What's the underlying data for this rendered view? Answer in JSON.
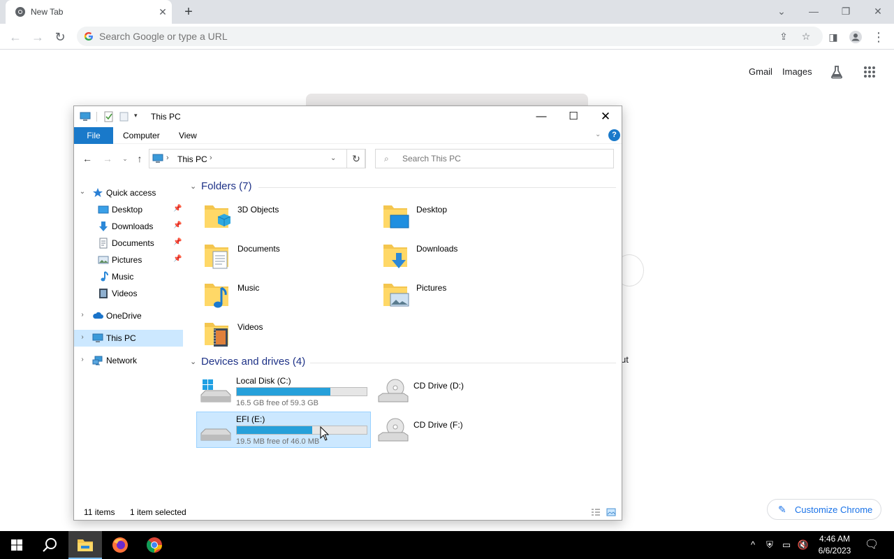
{
  "chrome": {
    "tab_title": "New Tab",
    "omnibox_placeholder": "Search Google or type a URL",
    "links": {
      "gmail": "Gmail",
      "images": "Images"
    },
    "partial_text": "ut",
    "customize_label": "Customize Chrome"
  },
  "explorer": {
    "title": "This PC",
    "ribbon_tabs": {
      "file": "File",
      "computer": "Computer",
      "view": "View"
    },
    "address_crumb": "This PC",
    "search_placeholder": "Search This PC",
    "tree": {
      "quick_access": "Quick access",
      "desktop": "Desktop",
      "downloads": "Downloads",
      "documents": "Documents",
      "pictures": "Pictures",
      "music": "Music",
      "videos": "Videos",
      "onedrive": "OneDrive",
      "this_pc": "This PC",
      "network": "Network"
    },
    "folders_header": "Folders (7)",
    "folders": [
      "3D Objects",
      "Desktop",
      "Documents",
      "Downloads",
      "Music",
      "Pictures",
      "Videos"
    ],
    "devices_header": "Devices and drives (4)",
    "drives": {
      "c": {
        "name": "Local Disk (C:)",
        "free": "16.5 GB free of 59.3 GB",
        "used_fraction": 0.72
      },
      "e": {
        "name": "EFI (E:)",
        "free": "19.5 MB free of 46.0 MB",
        "used_fraction": 0.58
      },
      "d": {
        "name": "CD Drive (D:)"
      },
      "f": {
        "name": "CD Drive (F:)"
      }
    },
    "status": {
      "items": "11 items",
      "selected": "1 item selected"
    }
  },
  "taskbar": {
    "time": "4:46 AM",
    "date": "6/6/2023"
  },
  "colors": {
    "accent": "#1979ca",
    "selection": "#cce8ff",
    "drive_bar": "#26a0da",
    "chrome_blue": "#1a73e8"
  }
}
